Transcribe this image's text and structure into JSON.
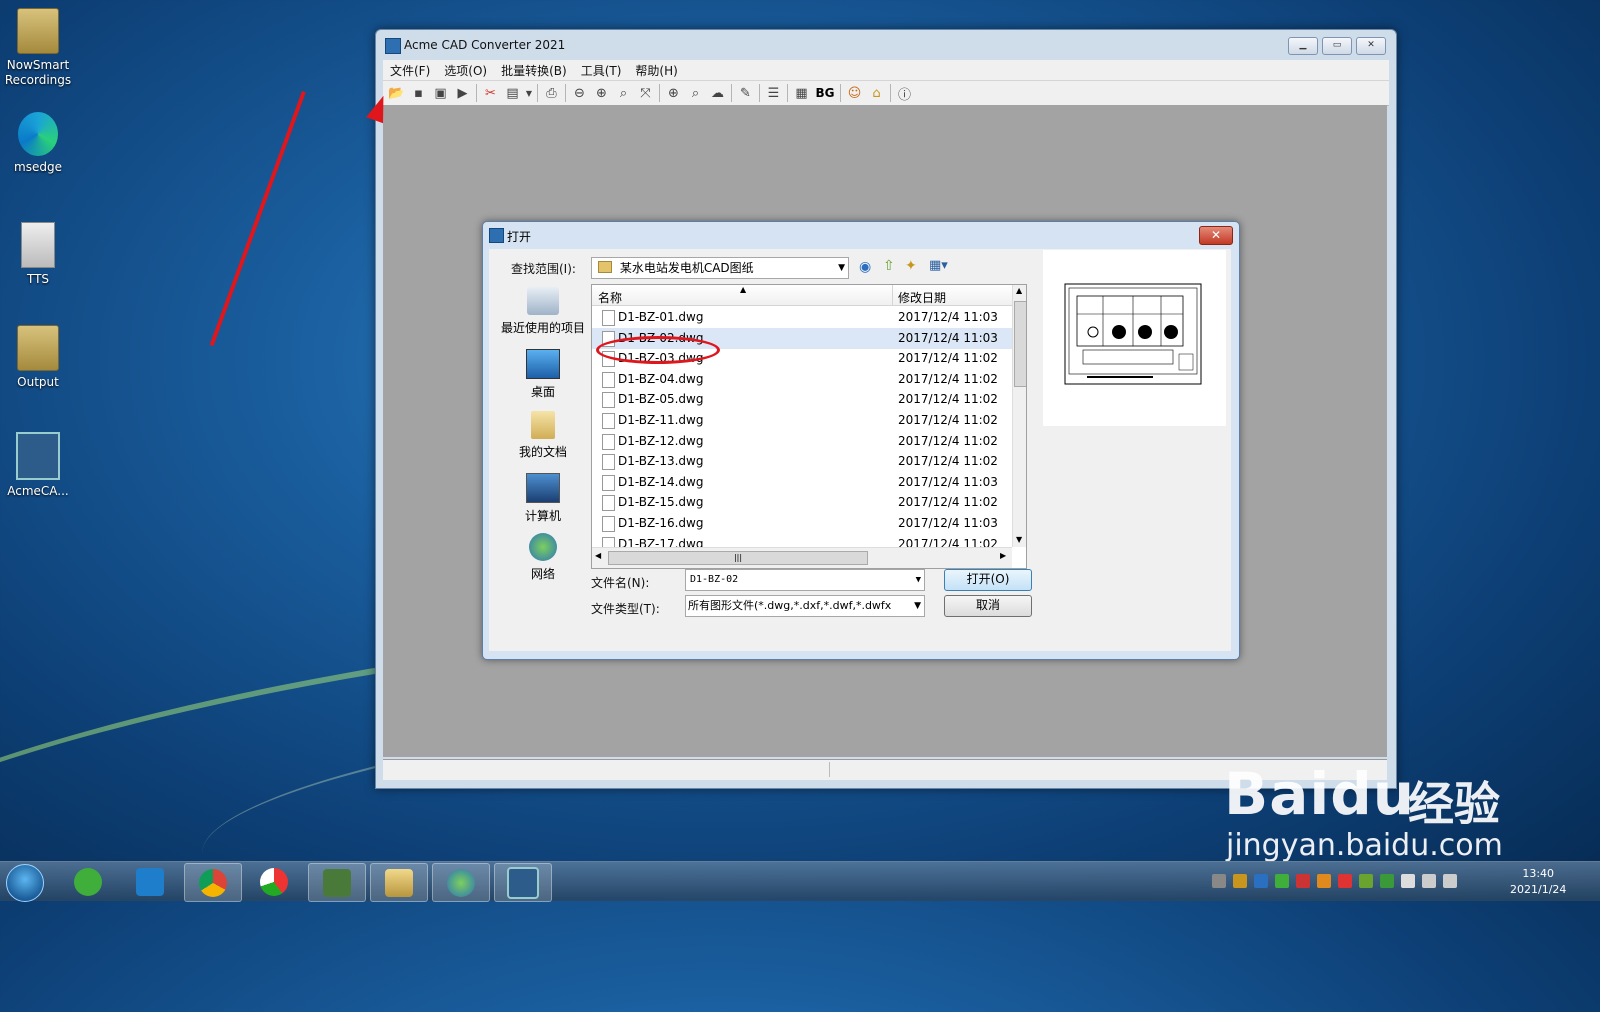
{
  "desktop": {
    "icons": [
      {
        "label": "NowSmart\nRecordings",
        "icon": "folder-icon"
      },
      {
        "label": "msedge",
        "icon": "edge-icon"
      },
      {
        "label": "TTS",
        "icon": "file-icon"
      },
      {
        "label": "Output",
        "icon": "folder-icon"
      },
      {
        "label": "AcmeCA...",
        "icon": "acme-app-icon"
      }
    ]
  },
  "window": {
    "title": "Acme CAD Converter 2021",
    "menu": [
      "文件(F)",
      "选项(O)",
      "批量转换(B)",
      "工具(T)",
      "帮助(H)"
    ],
    "toolbar_text_button": "BG"
  },
  "dialog": {
    "title": "打开",
    "lookin_label": "查找范围(I):",
    "lookin_value": "某水电站发电机CAD图纸",
    "places": [
      "最近使用的项目",
      "桌面",
      "我的文档",
      "计算机",
      "网络"
    ],
    "columns": {
      "name": "名称",
      "modified": "修改日期"
    },
    "files": [
      {
        "name": "D1-BZ-01.dwg",
        "date": "2017/12/4 11:03"
      },
      {
        "name": "D1-BZ-02.dwg",
        "date": "2017/12/4 11:03"
      },
      {
        "name": "D1-BZ-03.dwg",
        "date": "2017/12/4 11:02"
      },
      {
        "name": "D1-BZ-04.dwg",
        "date": "2017/12/4 11:02"
      },
      {
        "name": "D1-BZ-05.dwg",
        "date": "2017/12/4 11:02"
      },
      {
        "name": "D1-BZ-11.dwg",
        "date": "2017/12/4 11:02"
      },
      {
        "name": "D1-BZ-12.dwg",
        "date": "2017/12/4 11:02"
      },
      {
        "name": "D1-BZ-13.dwg",
        "date": "2017/12/4 11:02"
      },
      {
        "name": "D1-BZ-14.dwg",
        "date": "2017/12/4 11:03"
      },
      {
        "name": "D1-BZ-15.dwg",
        "date": "2017/12/4 11:02"
      },
      {
        "name": "D1-BZ-16.dwg",
        "date": "2017/12/4 11:03"
      },
      {
        "name": "D1-BZ-17.dwg",
        "date": "2017/12/4 11:02"
      }
    ],
    "filename_label": "文件名(N):",
    "filename_value": "D1-BZ-02",
    "filetype_label": "文件类型(T):",
    "filetype_value": "所有图形文件(*.dwg,*.dxf,*.dwf,*.dwfx",
    "open_button": "打开(O)",
    "cancel_button": "取消"
  },
  "taskbar": {
    "clock_time": "13:40",
    "clock_date": "2021/1/24"
  },
  "watermark": {
    "brand": "Baidu",
    "brand_cn": "经验",
    "url": "jingyan.baidu.com"
  },
  "colors": {
    "annotation": "#e0161d",
    "selection": "#dbe7f6"
  }
}
